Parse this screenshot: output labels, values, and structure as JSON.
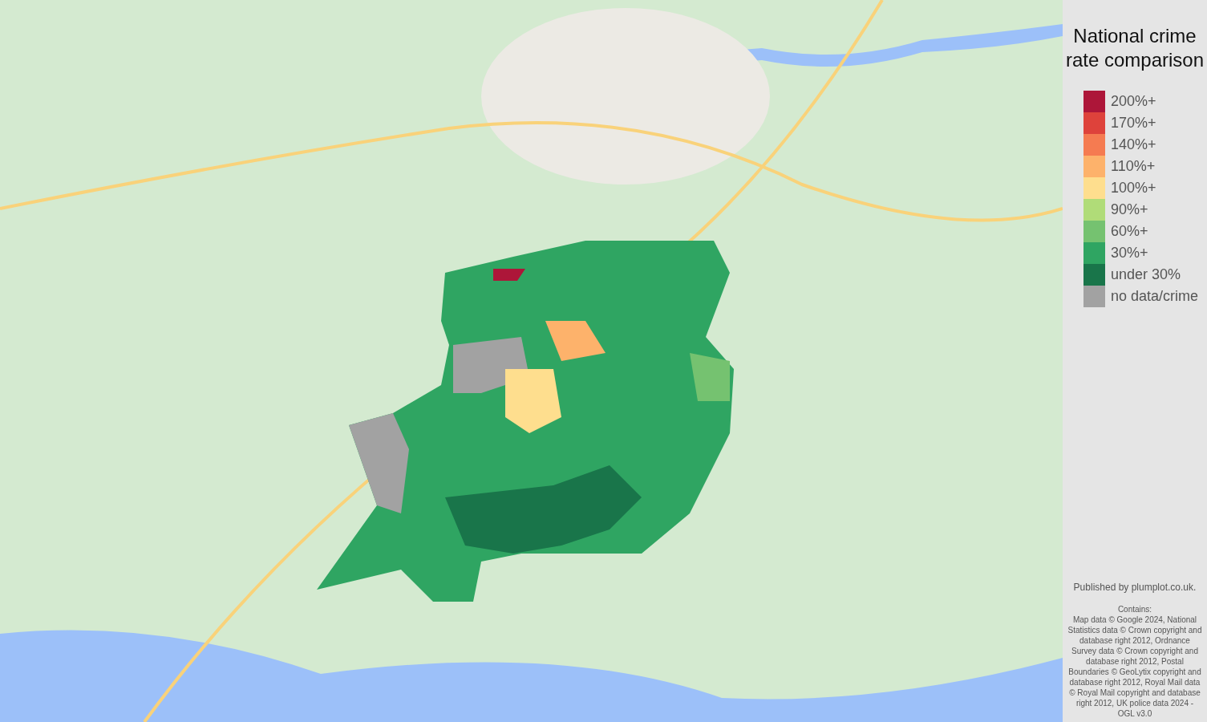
{
  "legend": {
    "title": "National crime rate comparison",
    "items": [
      {
        "label": "200%+",
        "color": "#ad1639"
      },
      {
        "label": "170%+",
        "color": "#de423b"
      },
      {
        "label": "140%+",
        "color": "#f57b51"
      },
      {
        "label": "110%+",
        "color": "#fdb26b"
      },
      {
        "label": "100%+",
        "color": "#fede8e"
      },
      {
        "label": "90%+",
        "color": "#b0dc78"
      },
      {
        "label": "60%+",
        "color": "#75c270"
      },
      {
        "label": "30%+",
        "color": "#2fa562"
      },
      {
        "label": "under 30%",
        "color": "#19754a"
      },
      {
        "label": "no data/crime",
        "color": "#a2a2a2"
      }
    ]
  },
  "credits": {
    "publisher": "Published by plumplot.co.uk.",
    "heading": "Contains:",
    "text": "Map data © Google 2024, National Statistics data © Crown copyright and database right 2012, Ordnance Survey data © Crown copyright and database right 2012, Postal Boundaries © GeoLytix copyright and database right 2012, Royal Mail data © Royal Mail copyright and database right 2012, UK police data 2024 - OGL v3.0"
  }
}
